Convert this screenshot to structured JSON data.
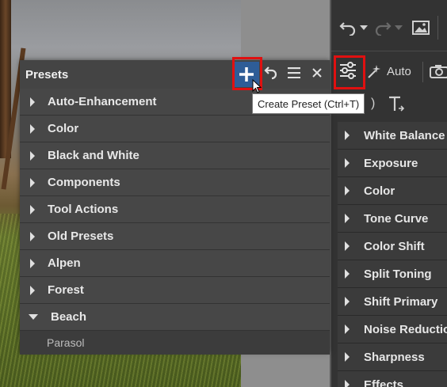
{
  "presets_panel": {
    "title": "Presets",
    "items": [
      {
        "label": "Auto-Enhancement",
        "expanded": false
      },
      {
        "label": "Color",
        "expanded": false
      },
      {
        "label": "Black and White",
        "expanded": false
      },
      {
        "label": "Components",
        "expanded": false
      },
      {
        "label": "Tool Actions",
        "expanded": false
      },
      {
        "label": "Old Presets",
        "expanded": false
      },
      {
        "label": "Alpen",
        "expanded": false
      },
      {
        "label": "Forest",
        "expanded": false
      },
      {
        "label": "Beach",
        "expanded": true
      }
    ],
    "sub_items": [
      "Parasol"
    ]
  },
  "tooltip": {
    "text": "Create Preset (Ctrl+T)"
  },
  "right_toolbar": {
    "auto_label": "Auto"
  },
  "adjustments": {
    "items": [
      "White Balance",
      "Exposure",
      "Color",
      "Tone Curve",
      "Color Shift",
      "Split Toning",
      "Shift Primary",
      "Noise Reduction",
      "Sharpness",
      "Effects"
    ]
  },
  "icons": {
    "undo": "undo-icon",
    "redo": "redo-icon",
    "image": "image-icon",
    "sliders": "sliders-icon",
    "wand": "magic-wand-icon",
    "camera": "camera-icon",
    "add": "plus-icon",
    "revert": "revert-icon",
    "menu": "menu-icon",
    "close": "close-icon"
  },
  "colors": {
    "highlight": "#e01010",
    "accent": "#2e5d97"
  }
}
